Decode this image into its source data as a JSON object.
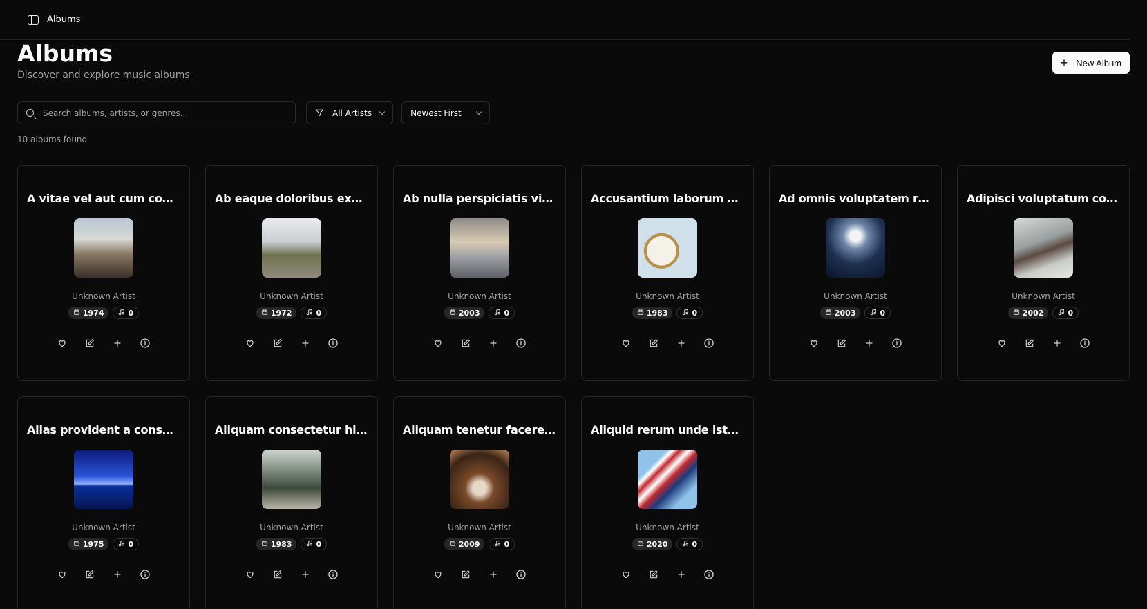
{
  "topbar": {
    "crumb": "Albums"
  },
  "header": {
    "title": "Albums",
    "subtitle": "Discover and explore music albums",
    "new_album_label": "New Album"
  },
  "filters": {
    "search_placeholder": "Search albums, artists, or genres...",
    "artist_filter": "All Artists",
    "sort": "Newest First"
  },
  "result_count": "10 albums found",
  "albums": [
    {
      "title": "A vitae vel aut cum consequuntur.",
      "artist": "Unknown Artist",
      "year": "1974",
      "tracks": "0"
    },
    {
      "title": "Ab eaque doloribus explicabo.",
      "artist": "Unknown Artist",
      "year": "1972",
      "tracks": "0"
    },
    {
      "title": "Ab nulla perspiciatis vitae quia.",
      "artist": "Unknown Artist",
      "year": "2003",
      "tracks": "0"
    },
    {
      "title": "Accusantium laborum aut omnis.",
      "artist": "Unknown Artist",
      "year": "1983",
      "tracks": "0"
    },
    {
      "title": "Ad omnis voluptatem ratione.",
      "artist": "Unknown Artist",
      "year": "2003",
      "tracks": "0"
    },
    {
      "title": "Adipisci voluptatum consequatur.",
      "artist": "Unknown Artist",
      "year": "2002",
      "tracks": "0"
    },
    {
      "title": "Alias provident a consectetur.",
      "artist": "Unknown Artist",
      "year": "1975",
      "tracks": "0"
    },
    {
      "title": "Aliquam consectetur hic dolor.",
      "artist": "Unknown Artist",
      "year": "1983",
      "tracks": "0"
    },
    {
      "title": "Aliquam tenetur facere consequatur.",
      "artist": "Unknown Artist",
      "year": "2009",
      "tracks": "0"
    },
    {
      "title": "Aliquid rerum unde iste sint.",
      "artist": "Unknown Artist",
      "year": "2020",
      "tracks": "0"
    }
  ]
}
